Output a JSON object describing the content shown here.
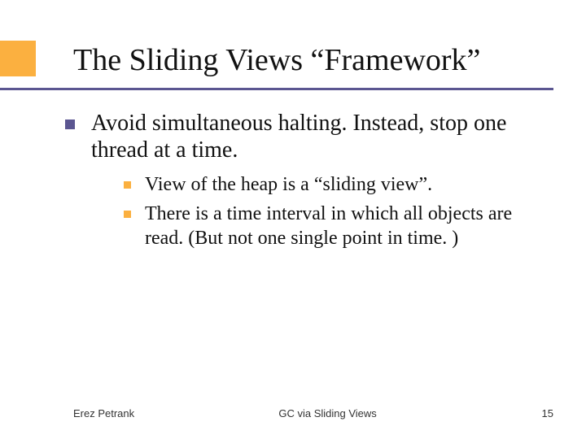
{
  "title": "The Sliding Views “Framework”",
  "bullets": [
    {
      "text": "Avoid simultaneous halting. Instead, stop one thread at a time.",
      "children": [
        {
          "text": "View of the heap is a “sliding view”."
        },
        {
          "text": "There is a time interval in which all objects are read. (But not one single point in time. )"
        }
      ]
    }
  ],
  "footer": {
    "left": "Erez Petrank",
    "center": "GC via Sliding Views",
    "page": "15"
  }
}
